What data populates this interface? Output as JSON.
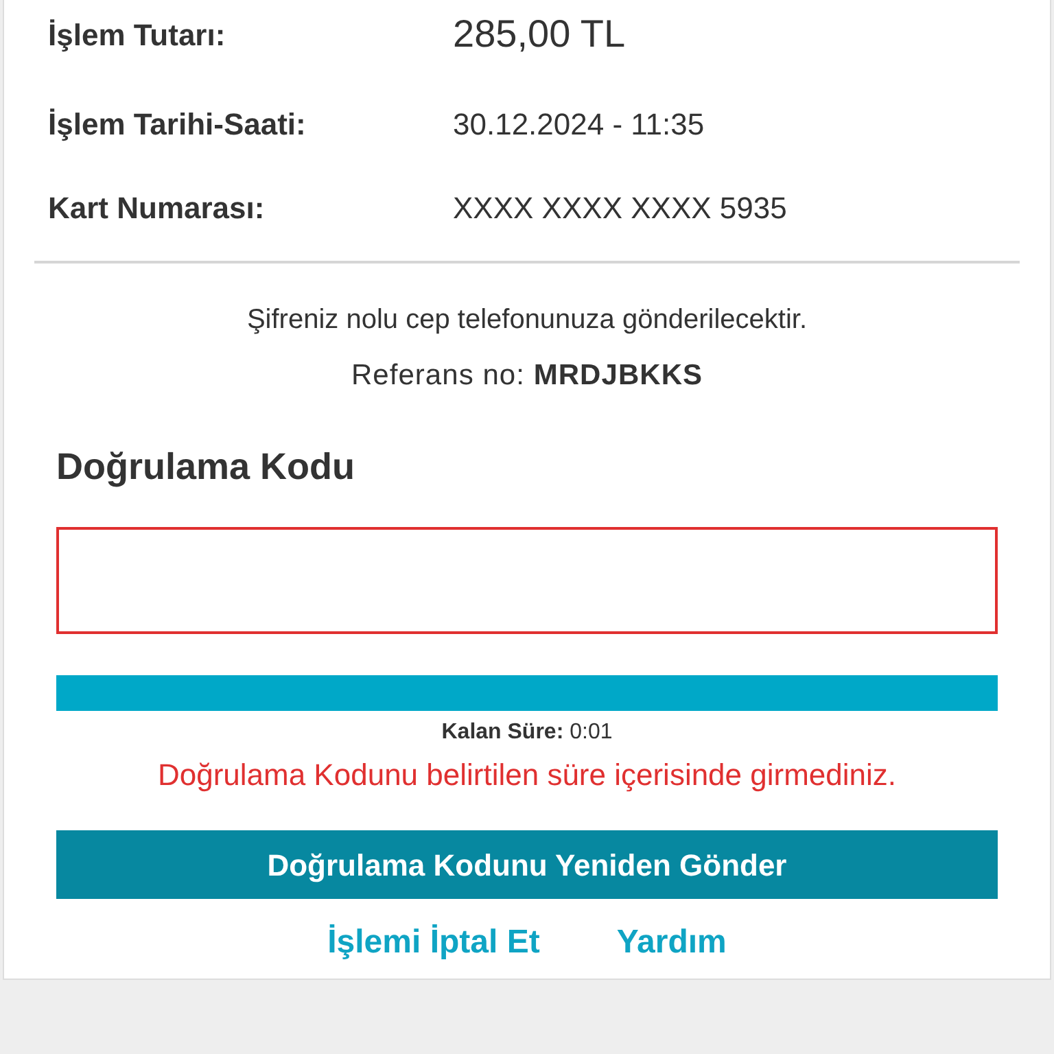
{
  "details": [
    {
      "label": "İşlem Tutarı:",
      "value": "285,00 TL",
      "kind": "amount"
    },
    {
      "label": "İşlem Tarihi-Saati:",
      "value": "30.12.2024 - 11:35",
      "kind": "plain"
    },
    {
      "label": "Kart Numarası:",
      "value": "XXXX XXXX XXXX 5935",
      "kind": "plain"
    }
  ],
  "info": "Şifreniz nolu cep telefonunuza gönderilecektir.",
  "reference": "Referans no: **MRDJBKKS**",
  "code_title": "Doğrulama Kodu",
  "code_field": {
    "invalid": true
  },
  "timer": {
    "level": 1,
    "text": "**Kalan Süre:** 0:01"
  },
  "error": "Doğrulama Kodunu belirtilen süre içerisinde girmediniz.",
  "resend_button": "Doğrulama Kodunu Yeniden Gönder",
  "links": [
    "İşlemi İptal Et",
    "Yardım"
  ]
}
